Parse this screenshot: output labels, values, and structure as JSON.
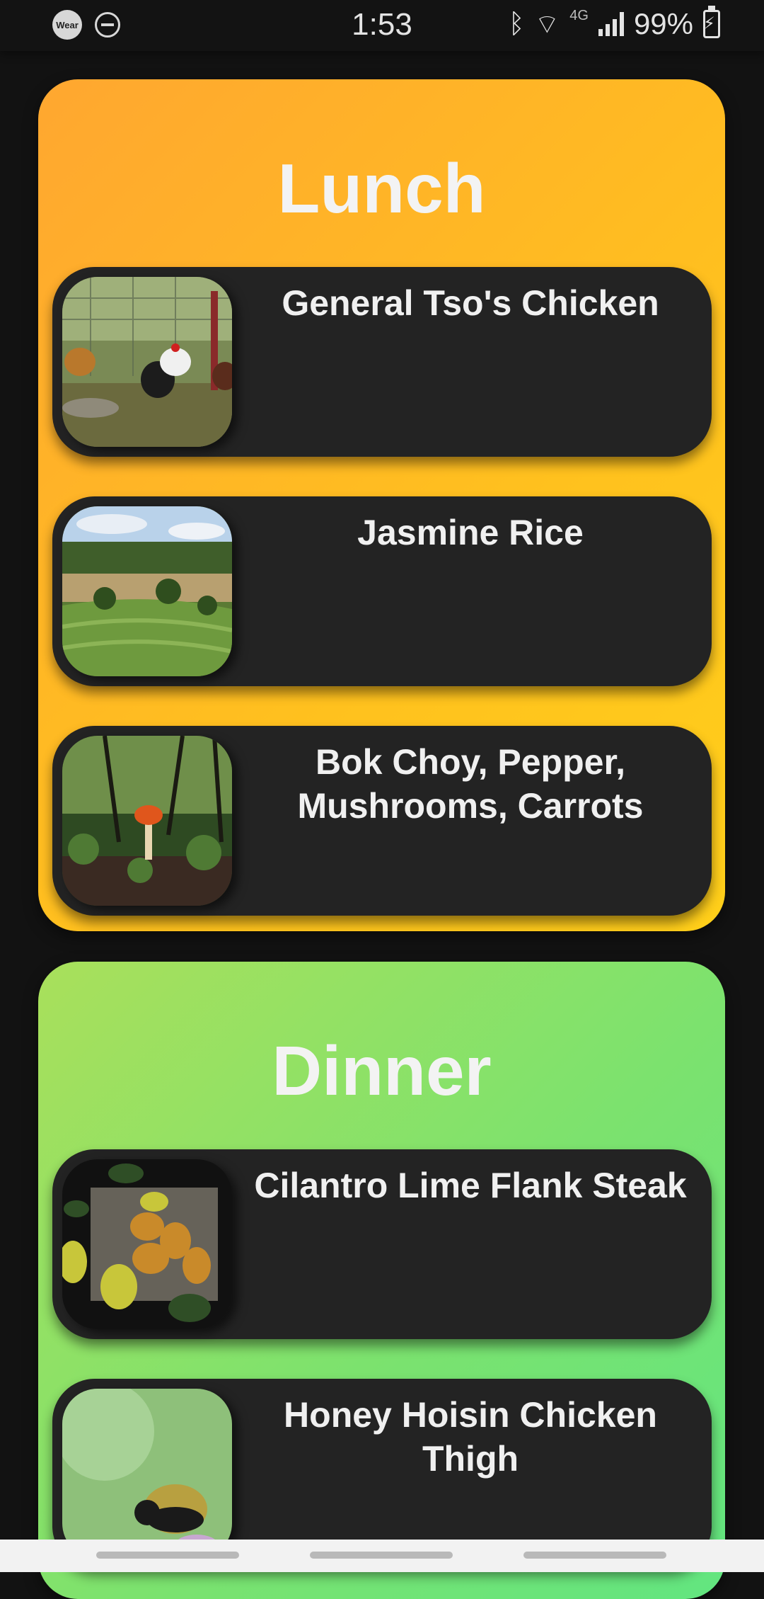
{
  "status_bar": {
    "time": "1:53",
    "battery": "99%",
    "wear_badge": "Wear",
    "network_label": "4G",
    "icons": [
      "wear-icon",
      "do-not-disturb-icon",
      "bluetooth-icon",
      "wifi-icon",
      "signal-icon",
      "battery-charging-icon"
    ]
  },
  "sections": [
    {
      "title": "Lunch",
      "items": [
        {
          "name": "General Tso's Chicken",
          "image": "chickens-photo"
        },
        {
          "name": "Jasmine Rice",
          "image": "rice-terrace-photo"
        },
        {
          "name": "Bok Choy, Pepper, Mushrooms, Carrots",
          "image": "mushroom-forest-photo"
        }
      ]
    },
    {
      "title": "Dinner",
      "items": [
        {
          "name": "Cilantro Lime Flank Steak",
          "image": "citrus-fruit-photo"
        },
        {
          "name": "Honey Hoisin Chicken Thigh",
          "image": "bumblebee-photo"
        }
      ]
    }
  ],
  "colors": {
    "lunch_gradient": [
      "#ffa730",
      "#ffcf1a"
    ],
    "dinner_gradient": [
      "#a9e05b",
      "#62e580"
    ],
    "card_background": "#232323",
    "page_background": "#121212"
  }
}
